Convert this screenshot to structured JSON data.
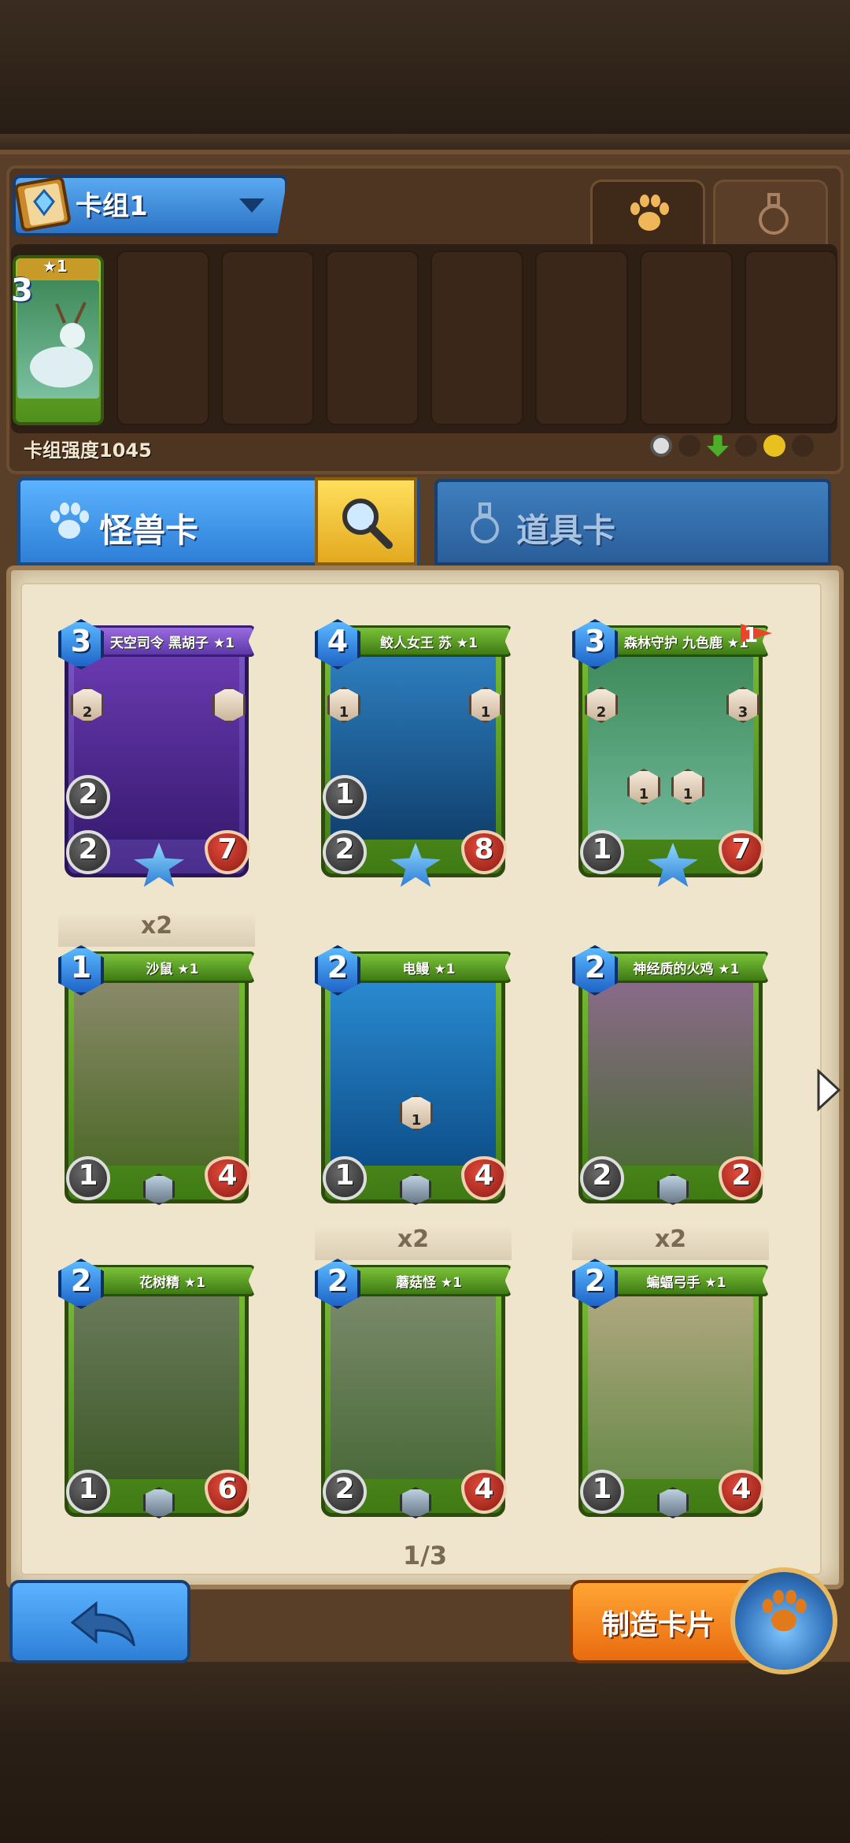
{
  "deck": {
    "title": "卡组1",
    "power_label": "卡组强度1045",
    "slot_card": {
      "cost": "3",
      "stars": "★1"
    }
  },
  "tabs": {
    "monster": "怪兽卡",
    "items": "道具卡"
  },
  "cards": [
    {
      "name": "天空司令 黑胡子 ★1",
      "cost": "3",
      "atk": "2",
      "hp": "7",
      "extra": "2",
      "abilities": [
        "2",
        ""
      ],
      "theme": "purple"
    },
    {
      "name": "鲛人女王 苏 ★1",
      "cost": "4",
      "atk": "2",
      "hp": "8",
      "extra": "1",
      "abilities": [
        "1",
        "1"
      ],
      "theme": "green"
    },
    {
      "name": "森林守护 九色鹿 ★1",
      "cost": "3",
      "atk": "1",
      "hp": "7",
      "extra": "",
      "abilities": [
        "2",
        "3",
        "1",
        "1"
      ],
      "theme": "green",
      "flag": "1"
    },
    {
      "name": "沙鼠 ★1",
      "cost": "1",
      "atk": "1",
      "hp": "4",
      "dup": "x2",
      "theme": "green"
    },
    {
      "name": "电鳗 ★1",
      "cost": "2",
      "atk": "1",
      "hp": "4",
      "abilities": [
        "1"
      ],
      "theme": "green"
    },
    {
      "name": "神经质的火鸡 ★1",
      "cost": "2",
      "atk": "2",
      "hp": "2",
      "theme": "green"
    },
    {
      "name": "花树精 ★1",
      "cost": "2",
      "atk": "1",
      "hp": "6",
      "theme": "green"
    },
    {
      "name": "蘑菇怪 ★1",
      "cost": "2",
      "atk": "2",
      "hp": "4",
      "dup": "x2",
      "theme": "green"
    },
    {
      "name": "蝙蝠弓手 ★1",
      "cost": "2",
      "atk": "1",
      "hp": "4",
      "dup": "x2",
      "theme": "green"
    }
  ],
  "pagination": "1/3",
  "buttons": {
    "craft": "制造卡片"
  },
  "colors": {
    "monster_tab": "#2d7fd6",
    "craft": "#e96b10",
    "card_green": "#3f7a14",
    "card_purple": "#4a2e8c",
    "cost_blue": "#1e64c8",
    "hp_red": "#8c1a12"
  }
}
